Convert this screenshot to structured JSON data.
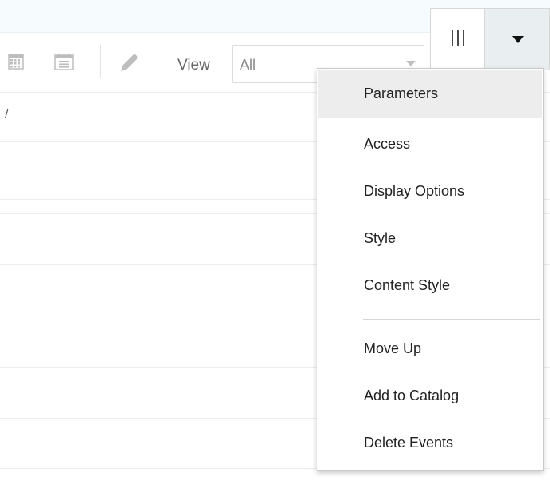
{
  "toolbar": {
    "view_label": "View",
    "view_select": {
      "value": "All"
    },
    "icons": [
      "calendar-month-icon",
      "calendar-list-icon",
      "pencil-icon",
      "chevron-down-icon"
    ]
  },
  "table": {
    "fragment_text": "/"
  },
  "header_buttons": {
    "columns_icon": "columns-icon",
    "menu_icon": "caret-down-icon"
  },
  "menu": {
    "highlighted_index": 0,
    "items": [
      {
        "label": "Parameters"
      },
      {
        "label": "Access"
      },
      {
        "label": "Display Options"
      },
      {
        "label": "Style"
      },
      {
        "label": "Content Style"
      },
      {
        "label": "Move Up"
      },
      {
        "label": "Add to Catalog"
      },
      {
        "label": "Delete Events"
      }
    ]
  },
  "colors": {
    "top_band": "#f6fbfd",
    "menu_button_bg": "#e9eef0",
    "highlight": "#ededed",
    "icon_gray": "#bdbdbd"
  }
}
